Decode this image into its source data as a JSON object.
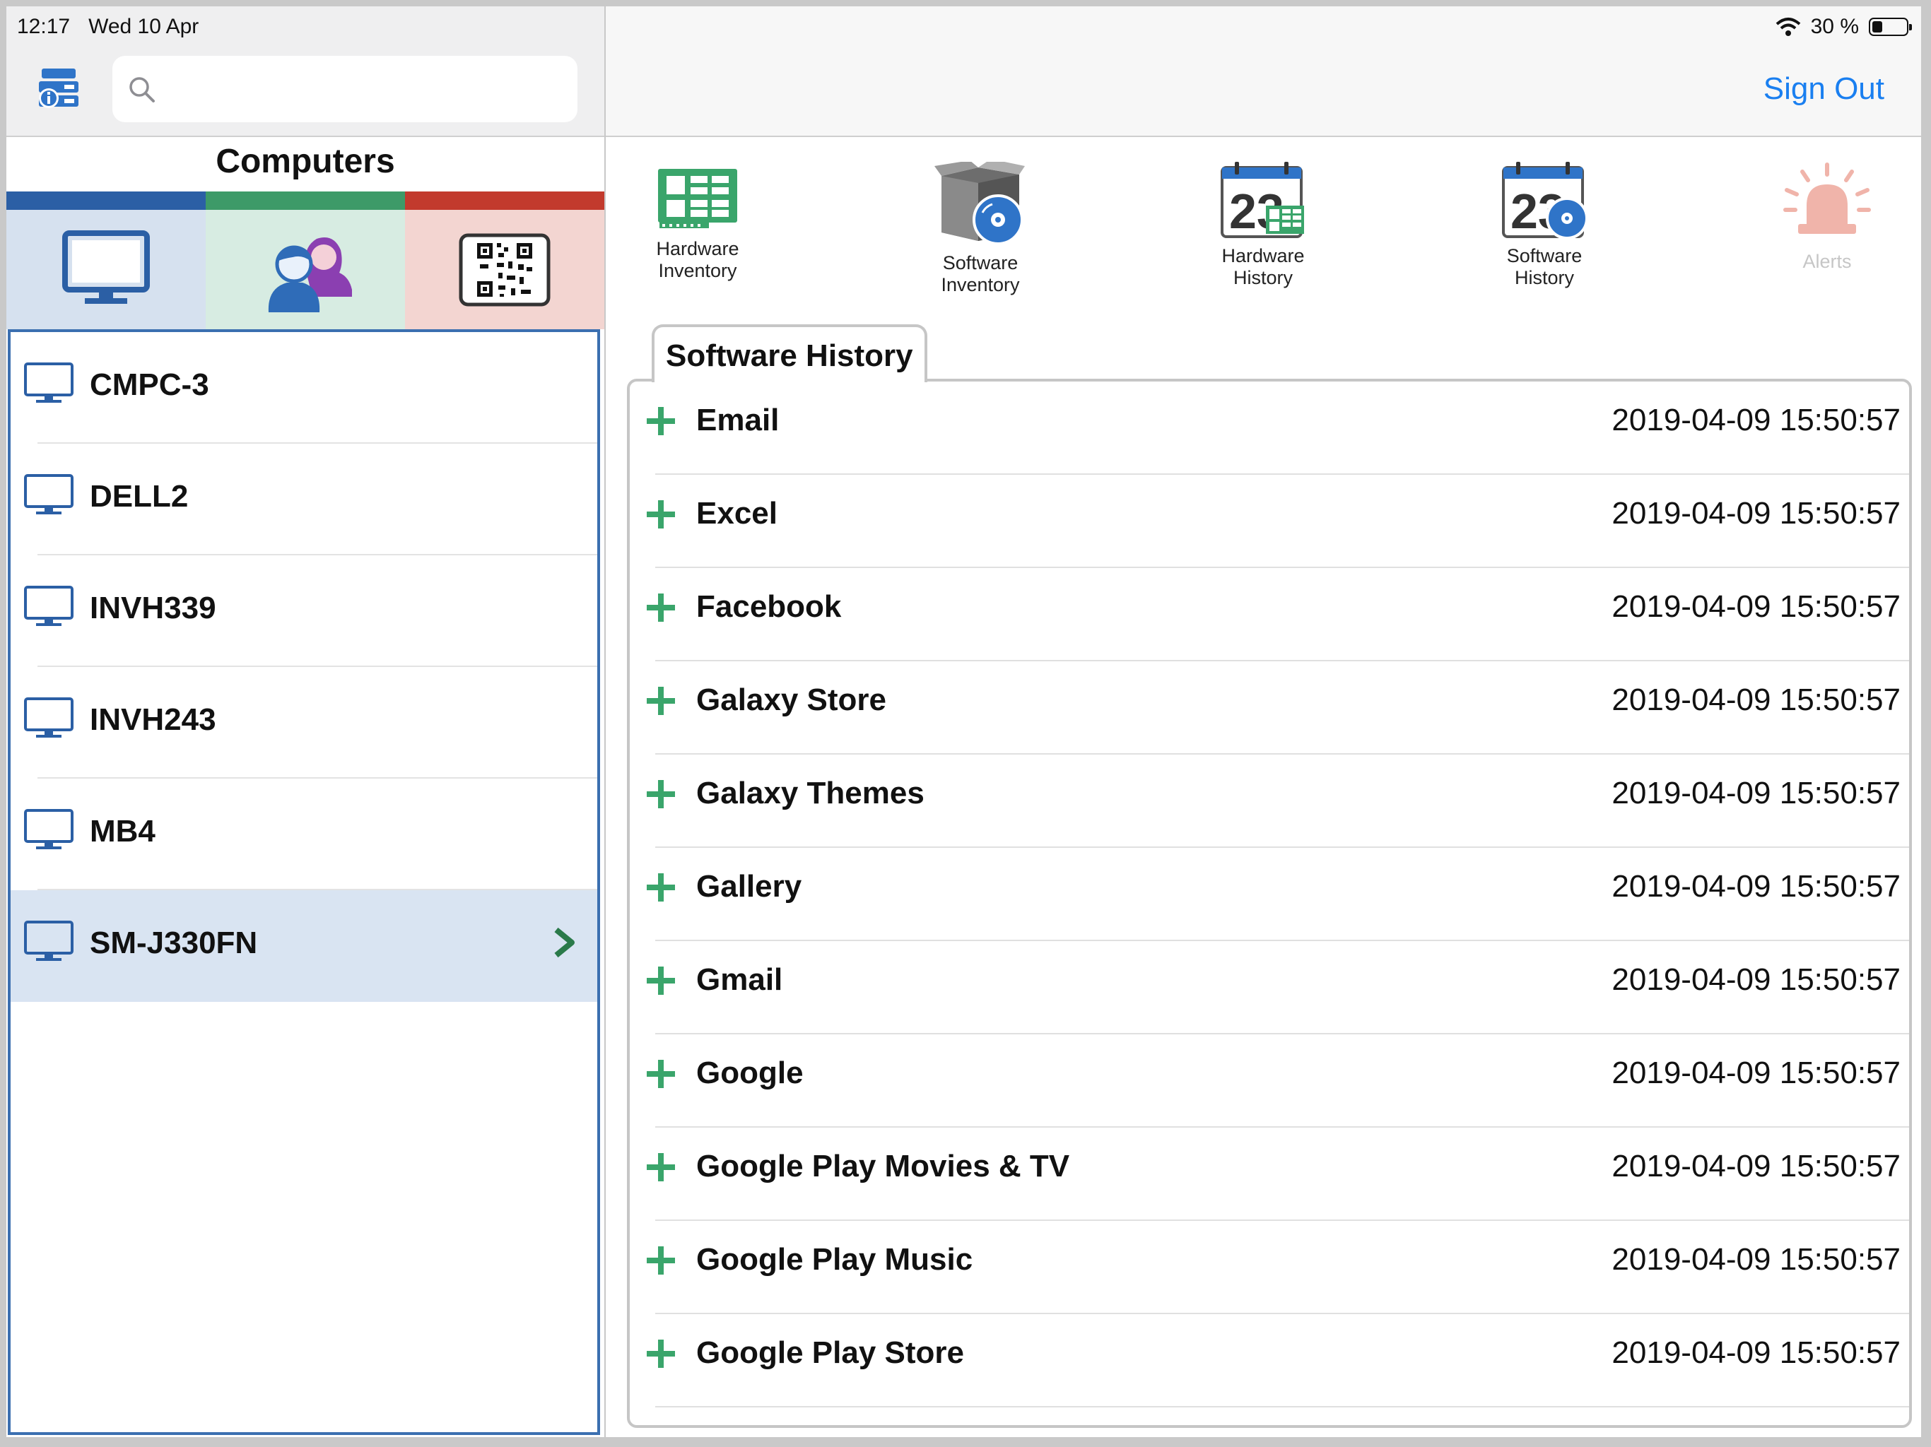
{
  "status_bar": {
    "time": "12:17",
    "date": "Wed 10 Apr",
    "battery": "30 %",
    "battery_level": 0.3
  },
  "search": {
    "placeholder": ""
  },
  "left_pane": {
    "title": "Computers",
    "tabs": [
      {
        "icon": "monitor-icon",
        "color": "#2b5fa5",
        "selected": true
      },
      {
        "icon": "users-icon",
        "color": "#3d9a68"
      },
      {
        "icon": "qr-code-icon",
        "color": "#c23a2d"
      }
    ],
    "computers": [
      {
        "name": "CMPC-3"
      },
      {
        "name": "DELL2"
      },
      {
        "name": "INVH339"
      },
      {
        "name": "INVH243"
      },
      {
        "name": "MB4"
      },
      {
        "name": "SM-J330FN",
        "selected": true
      }
    ]
  },
  "header": {
    "sign_out": "Sign Out",
    "accent": "#1a7ff0"
  },
  "toolbar": [
    {
      "label": "Hardware\nInventory",
      "icon": "hardware-inventory-icon"
    },
    {
      "label": "Software\nInventory",
      "icon": "software-inventory-icon"
    },
    {
      "label": "Hardware\nHistory",
      "icon": "hardware-history-icon"
    },
    {
      "label": "Software\nHistory",
      "icon": "software-history-icon"
    },
    {
      "label": "Alerts",
      "icon": "alert-siren-icon",
      "disabled": true
    }
  ],
  "section": {
    "title": "Software History",
    "rows": [
      {
        "app": "Email",
        "timestamp": "2019-04-09 15:50:57"
      },
      {
        "app": "Excel",
        "timestamp": "2019-04-09 15:50:57"
      },
      {
        "app": "Facebook",
        "timestamp": "2019-04-09 15:50:57"
      },
      {
        "app": "Galaxy Store",
        "timestamp": "2019-04-09 15:50:57"
      },
      {
        "app": "Galaxy Themes",
        "timestamp": "2019-04-09 15:50:57"
      },
      {
        "app": "Gallery",
        "timestamp": "2019-04-09 15:50:57"
      },
      {
        "app": "Gmail",
        "timestamp": "2019-04-09 15:50:57"
      },
      {
        "app": "Google",
        "timestamp": "2019-04-09 15:50:57"
      },
      {
        "app": "Google Play Movies & TV",
        "timestamp": "2019-04-09 15:50:57"
      },
      {
        "app": "Google Play Music",
        "timestamp": "2019-04-09 15:50:57"
      },
      {
        "app": "Google Play Store",
        "timestamp": "2019-04-09 15:50:57"
      }
    ]
  }
}
